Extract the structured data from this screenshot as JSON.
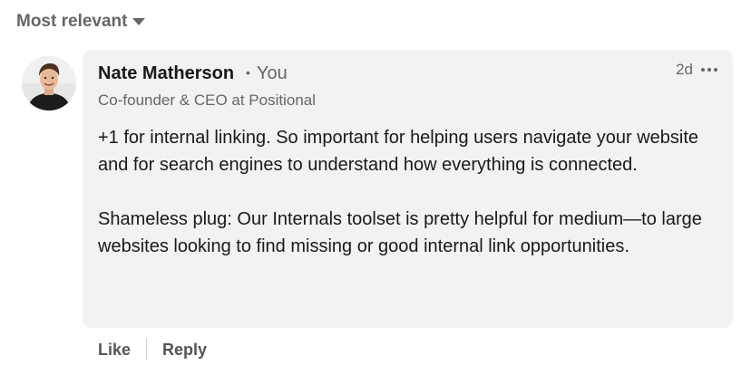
{
  "sort": {
    "label": "Most relevant",
    "caret_icon": "caret-down-icon"
  },
  "comment": {
    "author": {
      "name": "Nate Matherson",
      "separator": "•",
      "relation": "You",
      "headline": "Co-founder & CEO at Positional"
    },
    "time_ago": "2d",
    "paragraphs": [
      "+1 for internal linking. So important for helping users navigate your website and for search engines to understand how everything is connected.",
      "Shameless plug: Our Internals toolset is pretty helpful for medium—to large websites looking to find missing or good internal link opportunities."
    ],
    "actions": {
      "like": "Like",
      "reply": "Reply"
    }
  },
  "colors": {
    "comment_bg": "#f2f2f2",
    "muted_text": "#666666",
    "primary_text": "#191919"
  }
}
